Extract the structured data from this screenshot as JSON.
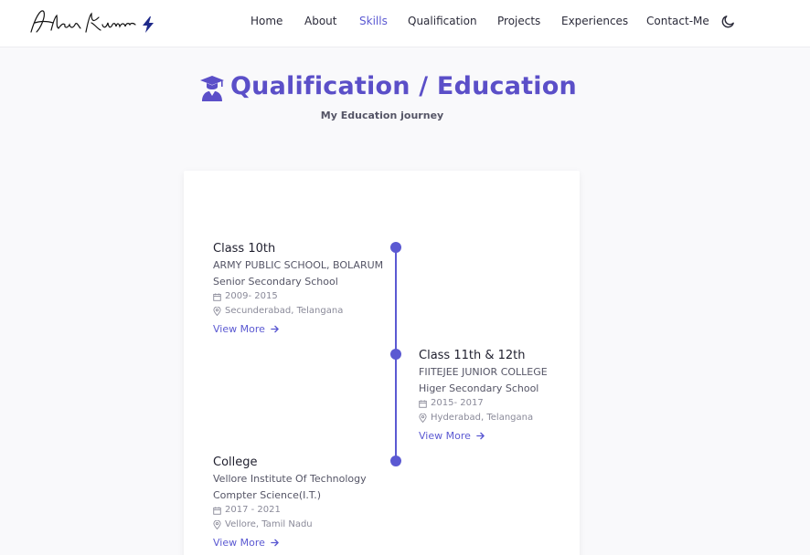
{
  "header": {
    "logo_alt": "Akash Kumar",
    "nav": [
      {
        "label": "Home",
        "active": false
      },
      {
        "label": "About",
        "active": false
      },
      {
        "label": "Skills",
        "active": true
      },
      {
        "label": "Qualification",
        "active": false
      },
      {
        "label": "Projects",
        "active": false
      },
      {
        "label": "Experiences",
        "active": false
      },
      {
        "label": "Contact-Me",
        "active": false
      }
    ],
    "theme_icon": "moon-icon"
  },
  "section": {
    "title": "Qualification / Education",
    "subtitle": "My Education journey",
    "title_icon": "graduate-icon"
  },
  "timeline": [
    {
      "title": "Class 10th",
      "institution": "ARMY PUBLIC SCHOOL, BOLARUM",
      "level": "Senior Secondary School",
      "years": "2009- 2015",
      "location": "Secunderabad, Telangana",
      "link": "View More"
    },
    {
      "title": "Class 11th & 12th",
      "institution": "FIITEJEE JUNIOR COLLEGE",
      "level": "Higer Secondary School",
      "years": "2015- 2017",
      "location": "Hyderabad, Telangana",
      "link": "View More"
    },
    {
      "title": "College",
      "institution": "Vellore Institute Of Technology",
      "level": "Compter Science(I.T.)",
      "years": "2017 - 2021",
      "location": "Vellore, Tamil Nadu",
      "link": "View More"
    }
  ],
  "colors": {
    "accent": "#5b59d2",
    "title": "#5b4fc8",
    "text": "#2b2b3a",
    "muted": "#8a8a99"
  }
}
